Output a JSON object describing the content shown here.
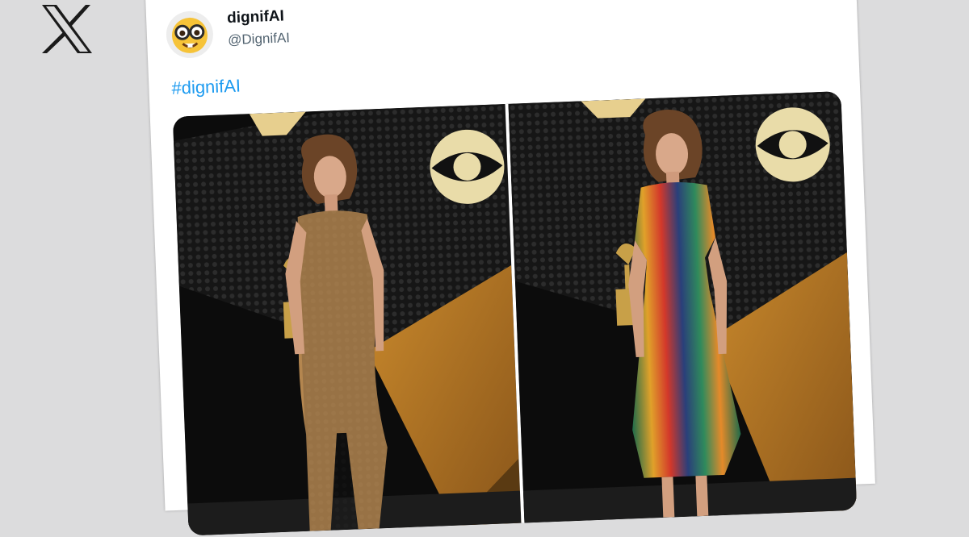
{
  "brand": {
    "logo_icon": "x-logo-icon"
  },
  "tweet": {
    "display_name": "dignifAI",
    "handle": "@DignifAI",
    "avatar_icon": "nerd-face-emoji-icon",
    "text": "#dignifAI",
    "hashtag_color": "#1d9bf0",
    "media": [
      {
        "photo_icon": "red-carpet-photo-gold-mesh-dress-icon"
      },
      {
        "photo_icon": "red-carpet-photo-rainbow-dress-icon"
      }
    ]
  }
}
